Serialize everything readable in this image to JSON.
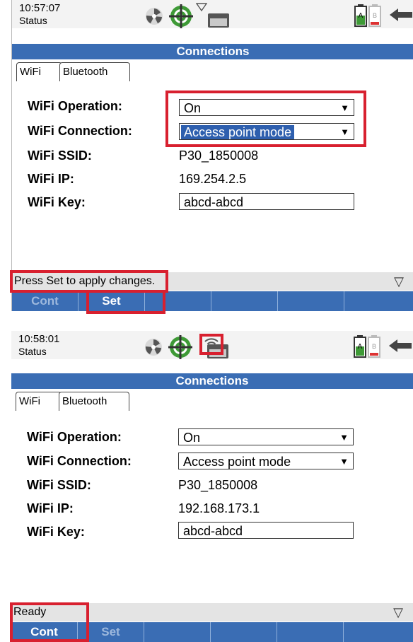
{
  "screens": [
    {
      "time": "10:57:07",
      "status_label": "Status",
      "title": "Connections",
      "tabs": [
        "WiFi",
        "Bluetooth"
      ],
      "fields": {
        "operation_label": "WiFi Operation:",
        "operation_value": "On",
        "connection_label": "WiFi Connection:",
        "connection_value": "Access point mode",
        "ssid_label": "WiFi SSID:",
        "ssid_value": "P30_1850008",
        "ip_label": "WiFi IP:",
        "ip_value": "169.254.2.5",
        "key_label": "WiFi Key:",
        "key_value": "abcd-abcd"
      },
      "status_message": "Press Set to apply changes.",
      "softkeys": [
        "Cont",
        "Set"
      ]
    },
    {
      "time": "10:58:01",
      "status_label": "Status",
      "title": "Connections",
      "tabs": [
        "WiFi",
        "Bluetooth"
      ],
      "fields": {
        "operation_label": "WiFi Operation:",
        "operation_value": "On",
        "connection_label": "WiFi Connection:",
        "connection_value": "Access point mode",
        "ssid_label": "WiFi SSID:",
        "ssid_value": "P30_1850008",
        "ip_label": "WiFi IP:",
        "ip_value": "192.168.173.1",
        "key_label": "WiFi Key:",
        "key_value": "abcd-abcd"
      },
      "status_message": "Ready",
      "softkeys": [
        "Cont",
        "Set"
      ]
    }
  ],
  "colors": {
    "title_bar": "#3a6db4",
    "highlight_box": "#d8202f",
    "selection": "#2e5fae"
  },
  "icons": [
    "pinwheel-icon",
    "target-icon",
    "wifi-icon",
    "memory-card-icon",
    "battery-a-icon",
    "battery-b-icon",
    "back-arrow-icon"
  ]
}
